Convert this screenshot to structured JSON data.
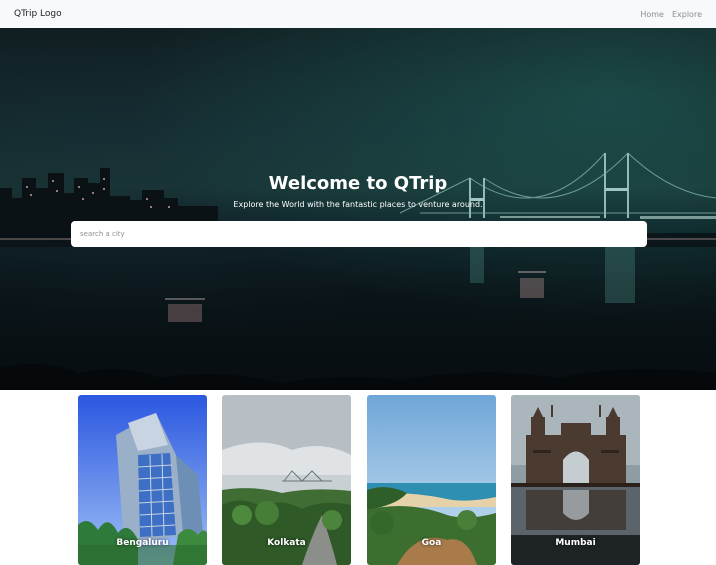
{
  "navbar": {
    "logo": "QTrip Logo",
    "links": [
      "Home",
      "Explore"
    ]
  },
  "hero": {
    "title": "Welcome to QTrip",
    "subtitle": "Explore the World with the fantastic places to venture around.",
    "search_placeholder": "search a city"
  },
  "cities": [
    {
      "name": "Bengaluru",
      "icon": "building-photo"
    },
    {
      "name": "Kolkata",
      "icon": "bridge-photo"
    },
    {
      "name": "Goa",
      "icon": "beach-photo"
    },
    {
      "name": "Mumbai",
      "icon": "gateway-photo"
    }
  ],
  "colors": {
    "navbar_bg": "#f8f9fa",
    "hero_dark": "#0f1a1d",
    "hero_teal": "#17302f",
    "text_white": "#ffffff"
  }
}
